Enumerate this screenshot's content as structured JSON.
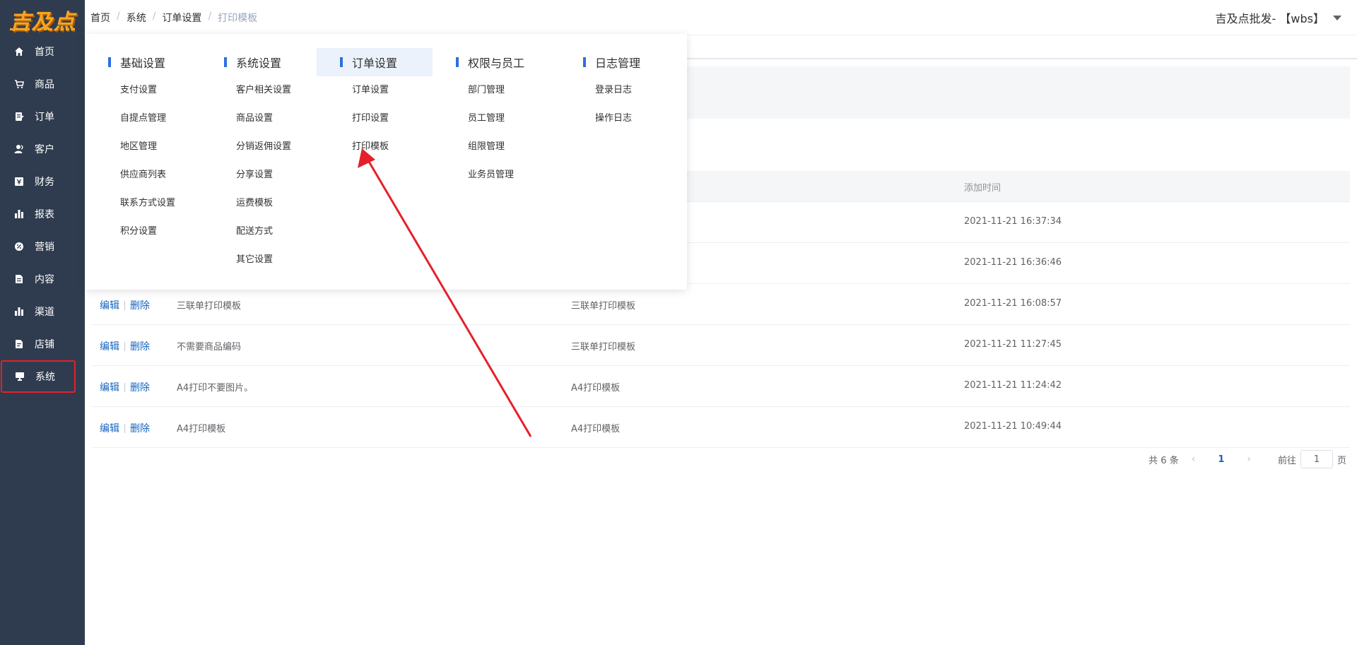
{
  "sidebar": {
    "logo": "吉及点",
    "items": [
      {
        "label": "首页",
        "icon": "home-icon"
      },
      {
        "label": "商品",
        "icon": "cart-icon"
      },
      {
        "label": "订单",
        "icon": "order-icon"
      },
      {
        "label": "客户",
        "icon": "customer-icon"
      },
      {
        "label": "财务",
        "icon": "finance-icon"
      },
      {
        "label": "报表",
        "icon": "report-icon"
      },
      {
        "label": "营销",
        "icon": "marketing-icon"
      },
      {
        "label": "内容",
        "icon": "content-icon"
      },
      {
        "label": "渠道",
        "icon": "channel-icon"
      },
      {
        "label": "店铺",
        "icon": "shop-icon"
      },
      {
        "label": "系统",
        "icon": "system-icon"
      }
    ],
    "active": "系统"
  },
  "header": {
    "breadcrumb": [
      "首页",
      "系统",
      "订单设置",
      "打印模板"
    ],
    "user": "吉及点批发- 【wbs】"
  },
  "menu": {
    "columns": [
      {
        "title": "基础设置",
        "items": [
          "支付设置",
          "自提点管理",
          "地区管理",
          "供应商列表",
          "联系方式设置",
          "积分设置"
        ]
      },
      {
        "title": "系统设置",
        "items": [
          "客户相关设置",
          "商品设置",
          "分销返佣设置",
          "分享设置",
          "运费模板",
          "配送方式",
          "其它设置"
        ]
      },
      {
        "title": "订单设置",
        "items": [
          "订单设置",
          "打印设置",
          "打印模板"
        ]
      },
      {
        "title": "权限与员工",
        "items": [
          "部门管理",
          "员工管理",
          "组限管理",
          "业务员管理"
        ]
      },
      {
        "title": "日志管理",
        "items": [
          "登录日志",
          "操作日志"
        ]
      }
    ],
    "highlighted_column": "订单设置"
  },
  "table": {
    "header_time": "添加时间",
    "edit_label": "编辑",
    "delete_label": "删除",
    "rows": [
      {
        "name": "",
        "type": "",
        "time": "2021-11-21 16:37:34"
      },
      {
        "name": "",
        "type": "",
        "time": "2021-11-21 16:36:46"
      },
      {
        "name": "三联单打印模板",
        "type": "三联单打印模板",
        "time": "2021-11-21 16:08:57"
      },
      {
        "name": "不需要商品编码",
        "type": "三联单打印模板",
        "time": "2021-11-21 11:27:45"
      },
      {
        "name": "A4打印不要图片。",
        "type": "A4打印模板",
        "time": "2021-11-21 11:24:42"
      },
      {
        "name": "A4打印模板",
        "type": "A4打印模板",
        "time": "2021-11-21 10:49:44"
      }
    ]
  },
  "pagination": {
    "total": "共 6 条",
    "current_page": "1",
    "goto_label": "前往",
    "goto_value": "1",
    "page_suffix": "页"
  },
  "colors": {
    "sidebar_bg": "#2f3c4f",
    "accent": "#2d6fdf",
    "link": "#1565c0",
    "annotation": "#e5202a"
  }
}
